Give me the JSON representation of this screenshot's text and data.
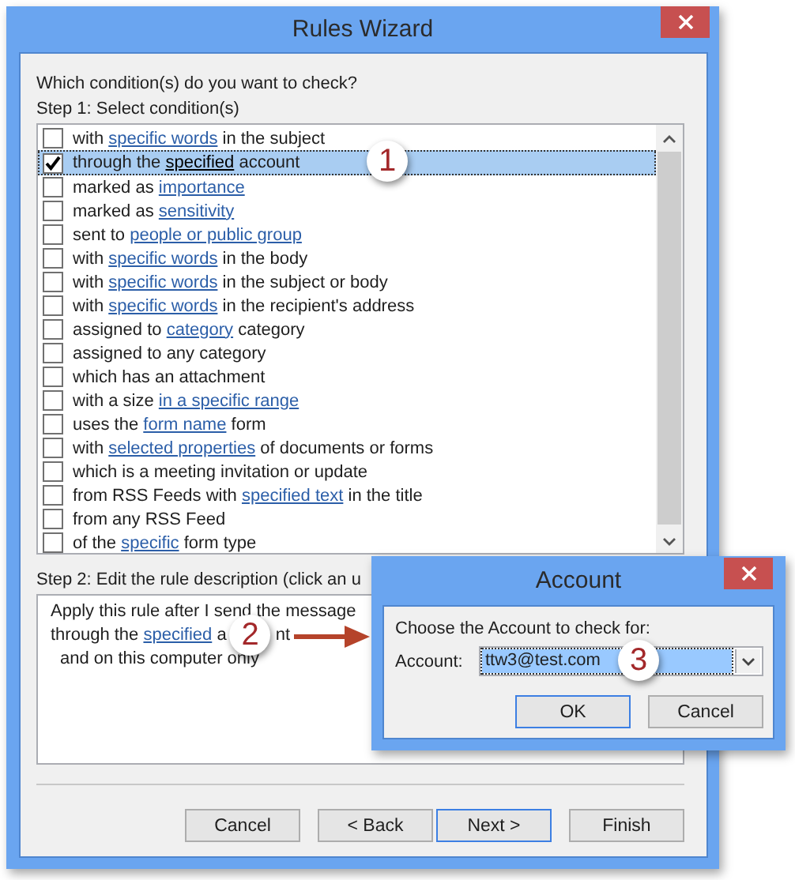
{
  "window": {
    "title": "Rules Wizard"
  },
  "prompt": "Which condition(s) do you want to check?",
  "step1_label": "Step 1: Select condition(s)",
  "conditions": [
    {
      "checked": false,
      "selected": false,
      "parts": [
        {
          "text": "with ",
          "link": false
        },
        {
          "text": "specific words",
          "link": true
        },
        {
          "text": " in the subject",
          "link": false
        }
      ]
    },
    {
      "checked": true,
      "selected": true,
      "callout": "1",
      "parts": [
        {
          "text": "through the ",
          "link": false
        },
        {
          "text": "specified",
          "link": true
        },
        {
          "text": " account",
          "link": false
        }
      ]
    },
    {
      "checked": false,
      "selected": false,
      "parts": [
        {
          "text": "marked as ",
          "link": false
        },
        {
          "text": "importance",
          "link": true
        }
      ]
    },
    {
      "checked": false,
      "selected": false,
      "parts": [
        {
          "text": "marked as ",
          "link": false
        },
        {
          "text": "sensitivity",
          "link": true
        }
      ]
    },
    {
      "checked": false,
      "selected": false,
      "parts": [
        {
          "text": "sent to ",
          "link": false
        },
        {
          "text": "people or public group",
          "link": true
        }
      ]
    },
    {
      "checked": false,
      "selected": false,
      "parts": [
        {
          "text": "with ",
          "link": false
        },
        {
          "text": "specific words",
          "link": true
        },
        {
          "text": " in the body",
          "link": false
        }
      ]
    },
    {
      "checked": false,
      "selected": false,
      "parts": [
        {
          "text": "with ",
          "link": false
        },
        {
          "text": "specific words",
          "link": true
        },
        {
          "text": " in the subject or body",
          "link": false
        }
      ]
    },
    {
      "checked": false,
      "selected": false,
      "parts": [
        {
          "text": "with ",
          "link": false
        },
        {
          "text": "specific words",
          "link": true
        },
        {
          "text": " in the recipient's address",
          "link": false
        }
      ]
    },
    {
      "checked": false,
      "selected": false,
      "parts": [
        {
          "text": "assigned to ",
          "link": false
        },
        {
          "text": "category",
          "link": true
        },
        {
          "text": " category",
          "link": false
        }
      ]
    },
    {
      "checked": false,
      "selected": false,
      "parts": [
        {
          "text": "assigned to any category",
          "link": false
        }
      ]
    },
    {
      "checked": false,
      "selected": false,
      "parts": [
        {
          "text": "which has an attachment",
          "link": false
        }
      ]
    },
    {
      "checked": false,
      "selected": false,
      "parts": [
        {
          "text": "with a size ",
          "link": false
        },
        {
          "text": "in a specific range",
          "link": true
        }
      ]
    },
    {
      "checked": false,
      "selected": false,
      "parts": [
        {
          "text": "uses the ",
          "link": false
        },
        {
          "text": "form name",
          "link": true
        },
        {
          "text": " form",
          "link": false
        }
      ]
    },
    {
      "checked": false,
      "selected": false,
      "parts": [
        {
          "text": "with ",
          "link": false
        },
        {
          "text": "selected properties",
          "link": true
        },
        {
          "text": " of documents or forms",
          "link": false
        }
      ]
    },
    {
      "checked": false,
      "selected": false,
      "parts": [
        {
          "text": "which is a meeting invitation or update",
          "link": false
        }
      ]
    },
    {
      "checked": false,
      "selected": false,
      "parts": [
        {
          "text": "from RSS Feeds with ",
          "link": false
        },
        {
          "text": "specified text",
          "link": true
        },
        {
          "text": " in the title",
          "link": false
        }
      ]
    },
    {
      "checked": false,
      "selected": false,
      "parts": [
        {
          "text": "from any RSS Feed",
          "link": false
        }
      ]
    },
    {
      "checked": false,
      "selected": false,
      "parts": [
        {
          "text": "of the ",
          "link": false
        },
        {
          "text": "specific",
          "link": true
        },
        {
          "text": " form type",
          "link": false
        }
      ]
    }
  ],
  "step2_label": "Step 2: Edit the rule description (click an u",
  "description": [
    {
      "parts": [
        {
          "text": "Apply this rule after I send the message",
          "link": false
        }
      ]
    },
    {
      "parts": [
        {
          "text": "through the ",
          "link": false
        },
        {
          "text": "specified",
          "link": true
        },
        {
          "text": " a",
          "link": false
        }
      ],
      "callout": "2",
      "after": [
        {
          "text": "nt",
          "link": false
        }
      ]
    },
    {
      "parts": [
        {
          "text": "and on this computer only",
          "link": false
        }
      ]
    }
  ],
  "buttons": [
    {
      "label": "Cancel",
      "default": false
    },
    {
      "label": "< Back",
      "default": false
    },
    {
      "label": "Next >",
      "default": true
    },
    {
      "label": "Finish",
      "default": false
    }
  ],
  "dialog": {
    "title": "Account",
    "prompt": "Choose the Account to check for:",
    "field_label": "Account:",
    "value": "ttw3@test.com",
    "callout": "3",
    "buttons": [
      {
        "label": "OK",
        "default": true
      },
      {
        "label": "Cancel",
        "default": false
      }
    ]
  }
}
